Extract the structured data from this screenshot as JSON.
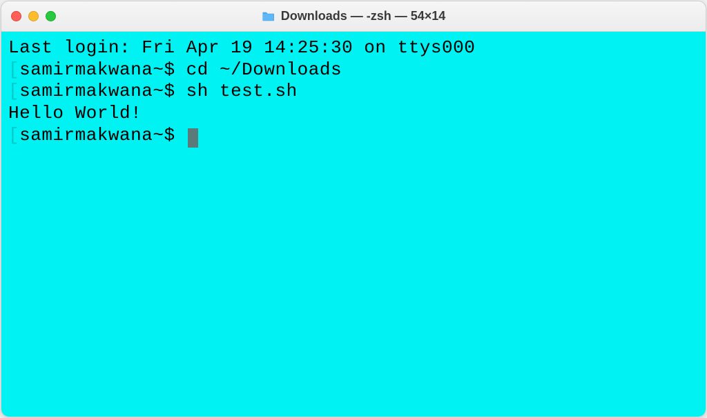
{
  "window": {
    "title": "Downloads — -zsh — 54×14"
  },
  "terminal": {
    "last_login": "Last login: Fri Apr 19 14:25:30 on ttys000",
    "lines": [
      {
        "bracket": "[",
        "prompt": "samirmakwana~$ ",
        "command": "cd ~/Downloads"
      },
      {
        "bracket": "[",
        "prompt": "samirmakwana~$ ",
        "command": "sh test.sh"
      }
    ],
    "output": "Hello World!",
    "current_prompt": {
      "bracket": "[",
      "prompt": "samirmakwana~$ "
    }
  }
}
